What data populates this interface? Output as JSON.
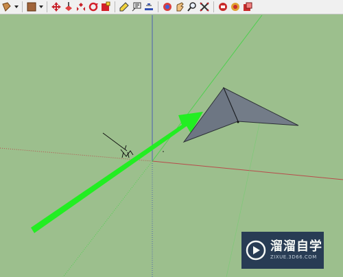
{
  "toolbar": {
    "groups": [
      [
        "paint-bucket-icon",
        "dropdown-arrow",
        "sep",
        "material-icon",
        "dropdown-arrow",
        "sep",
        "move-icon",
        "push-pull-icon",
        "rotate-icon",
        "scale-icon",
        "offset-icon",
        "sep",
        "tape-measure-icon",
        "text-icon",
        "protractor-icon",
        "sep",
        "orbit-icon",
        "pan-icon",
        "zoom-icon",
        "zoom-extents-icon",
        "sep",
        "warehouse-icon",
        "get-models-icon",
        "share-model-icon"
      ]
    ]
  },
  "colors": {
    "background": "#9cbf8d",
    "arrow": "#22ee22",
    "model_face": "#6d7683",
    "red_axis": "#b84a4a",
    "blue_axis": "#4b5fb3",
    "green_axis": "#4fd04f"
  },
  "watermark": {
    "title": "溜溜自学",
    "url": "ZIXUE.3D66.COM"
  }
}
